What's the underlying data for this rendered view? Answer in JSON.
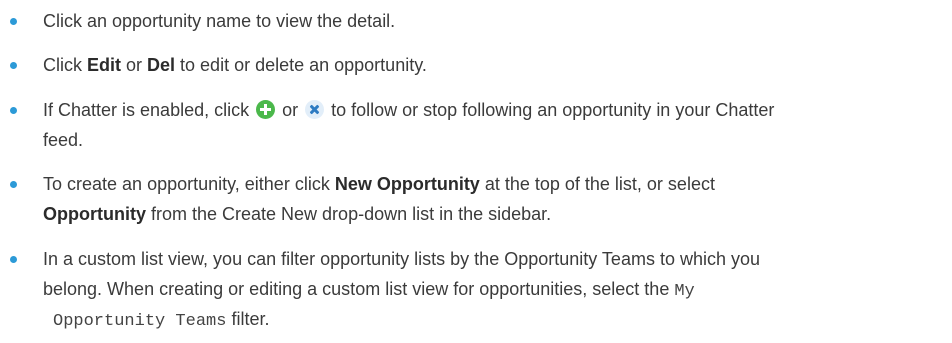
{
  "bullets": [
    {
      "lines": [
        {
          "segments": [
            "Click an opportunity name to view the detail."
          ]
        }
      ]
    },
    {
      "lines": [
        {
          "segments": [
            "Click ",
            "Edit",
            " or ",
            "Del",
            " to edit or delete an opportunity."
          ]
        }
      ]
    },
    {
      "lines": [
        {
          "segments": [
            "If Chatter is enabled, click ",
            " or ",
            " to follow or stop following an opportunity in your Chatter"
          ]
        },
        {
          "segments": [
            "feed."
          ]
        }
      ],
      "icons": [
        "plus-follow-icon",
        "x-unfollow-icon"
      ]
    },
    {
      "lines": [
        {
          "segments": [
            "To create an opportunity, either click ",
            "New Opportunity",
            " at the top of the list, or select"
          ]
        },
        {
          "segments": [
            "Opportunity",
            " from the Create New drop-down list in the sidebar."
          ]
        }
      ]
    },
    {
      "lines": [
        {
          "segments": [
            "In a custom list view, you can filter opportunity lists by the Opportunity Teams to which you"
          ]
        },
        {
          "segments": [
            "belong. When creating or editing a custom list view for opportunities, select the ",
            "My"
          ]
        },
        {
          "segments": [
            "Opportunity Teams",
            " filter."
          ]
        }
      ]
    }
  ],
  "colors": {
    "bullet": "#2c9ad7",
    "text": "#3b3b3b",
    "follow_icon": "#4bb84b",
    "unfollow_icon": "#2d7bc2"
  }
}
